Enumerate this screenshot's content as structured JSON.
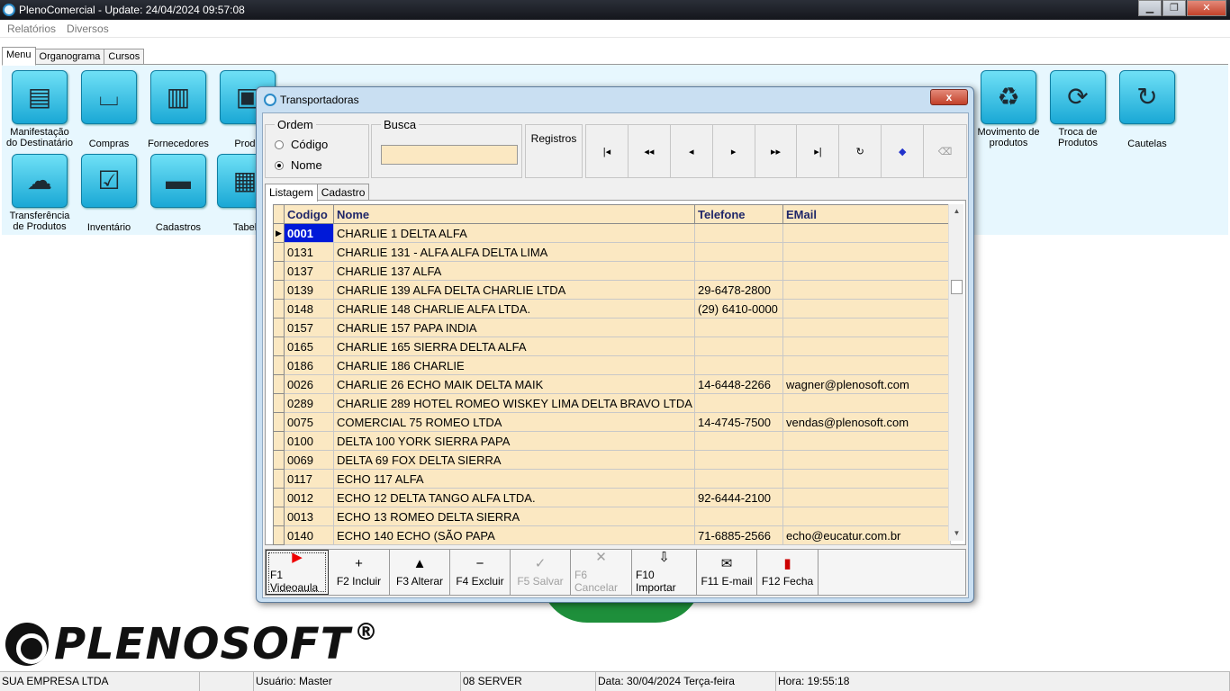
{
  "window": {
    "title": "PlenoComercial - Update: 24/04/2024 09:57:08"
  },
  "menubar": [
    "Relatórios",
    "Diversos"
  ],
  "main_tabs": [
    "Menu",
    "Organograma",
    "Cursos"
  ],
  "menu_icons": [
    {
      "label": "Manifestação do Destinatário",
      "icon": "document-check-icon"
    },
    {
      "label": "Compras",
      "icon": "shopping-bag-icon"
    },
    {
      "label": "Fornecedores",
      "icon": "factory-icon"
    },
    {
      "label": "Produ",
      "icon": "box-icon"
    },
    {
      "label": "Movimento de produtos",
      "icon": "recycle-icon"
    },
    {
      "label": "Troca de Produtos",
      "icon": "exchange-icon"
    },
    {
      "label": "Cautelas",
      "icon": "refresh-icon"
    },
    {
      "label": "Transferência de Produtos",
      "icon": "cloud-upload-icon"
    },
    {
      "label": "Inventário",
      "icon": "clipboard-check-icon"
    },
    {
      "label": "Cadastros",
      "icon": "folder-icon"
    },
    {
      "label": "Tabel",
      "icon": "grid-table-icon"
    }
  ],
  "logo": {
    "text": "PLENOSOFT",
    "reg": "®"
  },
  "statusbar": [
    "SUA EMPRESA LTDA",
    "",
    "Usuário: Master",
    "08 SERVER",
    "Data: 30/04/2024 Terça-feira",
    "Hora: 19:55:18"
  ],
  "dialog": {
    "title": "Transportadoras",
    "close": "x",
    "ordem": {
      "legend": "Ordem",
      "options": [
        {
          "label": "Código",
          "checked": false
        },
        {
          "label": "Nome",
          "checked": true
        }
      ]
    },
    "busca": {
      "legend": "Busca",
      "value": ""
    },
    "registros": "Registros",
    "nav_buttons": [
      {
        "name": "first-record",
        "glyph": "|◂"
      },
      {
        "name": "prior-page",
        "glyph": "◂◂"
      },
      {
        "name": "prior-record",
        "glyph": "◂"
      },
      {
        "name": "next-record",
        "glyph": "▸"
      },
      {
        "name": "next-page",
        "glyph": "▸▸"
      },
      {
        "name": "last-record",
        "glyph": "▸|"
      },
      {
        "name": "refresh",
        "glyph": "↻"
      },
      {
        "name": "bookmark",
        "glyph": "◆"
      },
      {
        "name": "goto",
        "glyph": "⌫"
      }
    ],
    "inner_tabs": [
      "Listagem",
      "Cadastro"
    ],
    "columns": [
      "Codigo",
      "Nome",
      "Telefone",
      "EMail"
    ],
    "rows": [
      [
        "0001",
        "CHARLIE 1 DELTA ALFA",
        "",
        ""
      ],
      [
        "0131",
        "CHARLIE 131 - ALFA ALFA DELTA LIMA",
        "",
        ""
      ],
      [
        "0137",
        "CHARLIE 137 ALFA",
        "",
        ""
      ],
      [
        "0139",
        "CHARLIE 139 ALFA DELTA CHARLIE LTDA",
        "29-6478-2800",
        ""
      ],
      [
        "0148",
        "CHARLIE 148 CHARLIE ALFA LTDA.",
        "(29) 6410-0000",
        ""
      ],
      [
        "0157",
        "CHARLIE 157 PAPA INDIA",
        "",
        ""
      ],
      [
        "0165",
        "CHARLIE 165 SIERRA DELTA ALFA",
        "",
        ""
      ],
      [
        "0186",
        "CHARLIE 186 CHARLIE",
        "",
        ""
      ],
      [
        "0026",
        "CHARLIE 26 ECHO MAIK DELTA MAIK",
        "14-6448-2266",
        "wagner@plenosoft.com"
      ],
      [
        "0289",
        "CHARLIE 289 HOTEL ROMEO WISKEY LIMA DELTA BRAVO LTDA",
        "",
        ""
      ],
      [
        "0075",
        "COMERCIAL 75 ROMEO LTDA",
        "14-4745-7500",
        "vendas@plenosoft.com"
      ],
      [
        "0100",
        "DELTA 100 YORK SIERRA PAPA",
        "",
        ""
      ],
      [
        "0069",
        "DELTA 69 FOX DELTA SIERRA",
        "",
        ""
      ],
      [
        "0117",
        "ECHO 117 ALFA",
        "",
        ""
      ],
      [
        "0012",
        "ECHO 12 DELTA TANGO ALFA LTDA.",
        "92-6444-2100",
        ""
      ],
      [
        "0013",
        "ECHO 13 ROMEO DELTA SIERRA",
        "",
        ""
      ],
      [
        "0140",
        "ECHO 140 ECHO (SÃO PAPA",
        "71-6885-2566",
        "echo@eucatur.com.br"
      ]
    ],
    "actions": [
      {
        "label": "F1 Videoaula",
        "icon": "youtube-icon",
        "glyph": "▶",
        "disabled": false
      },
      {
        "label": "F2 Incluir",
        "icon": "plus-icon",
        "glyph": "+",
        "disabled": false
      },
      {
        "label": "F3 Alterar",
        "icon": "triangle-up-icon",
        "glyph": "▲",
        "disabled": false
      },
      {
        "label": "F4 Excluir",
        "icon": "minus-icon",
        "glyph": "−",
        "disabled": false
      },
      {
        "label": "F5 Salvar",
        "icon": "check-icon",
        "glyph": "✓",
        "disabled": true
      },
      {
        "label": "F6 Cancelar",
        "icon": "x-icon",
        "glyph": "✕",
        "disabled": true
      },
      {
        "label": "F10 Importar",
        "icon": "import-icon",
        "glyph": "⇩",
        "disabled": false
      },
      {
        "label": "F11 E-mail",
        "icon": "envelope-icon",
        "glyph": "✉",
        "disabled": false
      },
      {
        "label": "F12 Fecha",
        "icon": "door-icon",
        "glyph": "▮",
        "disabled": false
      }
    ]
  }
}
